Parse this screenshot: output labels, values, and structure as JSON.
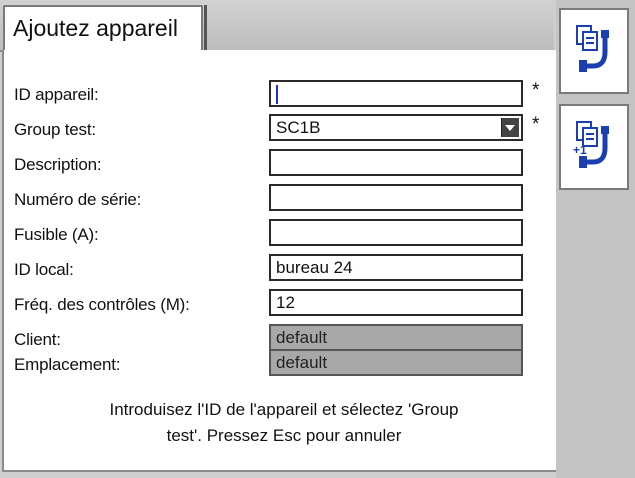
{
  "tab": {
    "title": "Ajoutez appareil"
  },
  "form": {
    "rows": [
      {
        "label": "ID appareil:",
        "value": "",
        "required_mark": "*"
      },
      {
        "label": "Group test:",
        "value": "SC1B",
        "required_mark": "*"
      },
      {
        "label": "Description:",
        "value": ""
      },
      {
        "label": "Numéro de série:",
        "value": ""
      },
      {
        "label": "Fusible (A):",
        "value": ""
      },
      {
        "label": "ID local:",
        "value": "bureau 24"
      },
      {
        "label": "Fréq. des contrôles (M):",
        "value": "12"
      },
      {
        "label": "Client:",
        "value": "default"
      },
      {
        "label": "Emplacement:",
        "value": "default"
      }
    ]
  },
  "hint": {
    "line1": "Introduisez l'ID de l'appareil et sélectez 'Group",
    "line2": "test'.  Pressez Esc pour annuler"
  },
  "sidebar": {
    "buttons": [
      {
        "icon": "add-appliance-icon"
      },
      {
        "icon": "add-appliance-plus-one-icon",
        "badge": "+1"
      }
    ]
  }
}
